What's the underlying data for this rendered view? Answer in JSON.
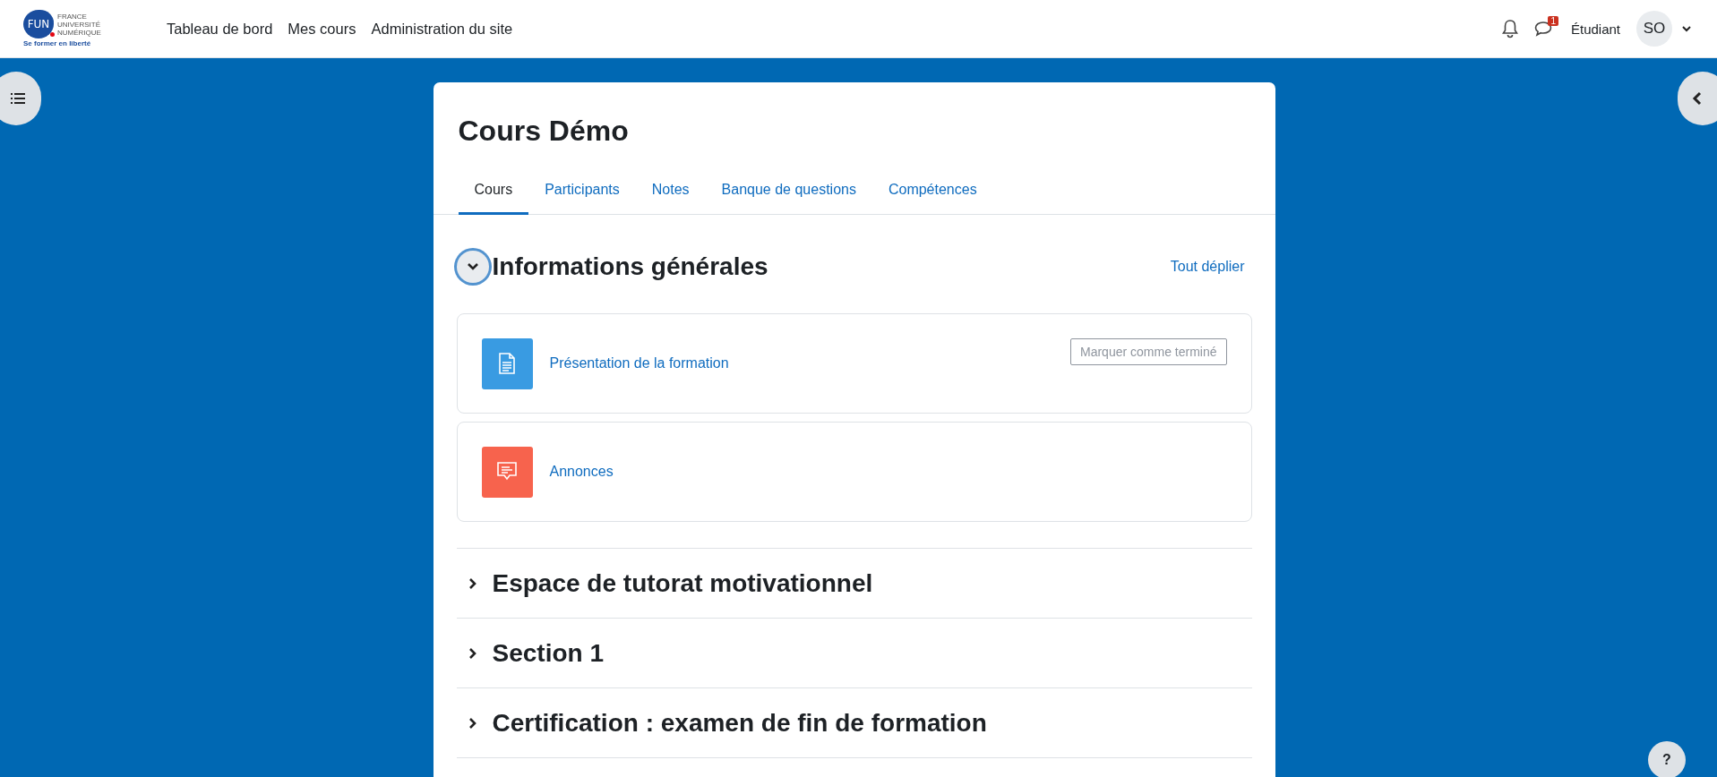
{
  "logo": {
    "mark": "FUN",
    "lines": [
      "FRANCE",
      "UNIVERSITÉ",
      "NUMÉRIQUE"
    ],
    "tagline": "Se former en liberté"
  },
  "nav": [
    {
      "label": "Tableau de bord"
    },
    {
      "label": "Mes cours"
    },
    {
      "label": "Administration du site"
    }
  ],
  "user": {
    "message_count": "1",
    "role": "Étudiant",
    "initials": "SO"
  },
  "course": {
    "title": "Cours Démo",
    "tabs": [
      {
        "label": "Cours",
        "selected": true
      },
      {
        "label": "Participants",
        "selected": false
      },
      {
        "label": "Notes",
        "selected": false
      },
      {
        "label": "Banque de questions",
        "selected": false
      },
      {
        "label": "Compétences",
        "selected": false
      }
    ],
    "expand_all": "Tout déplier",
    "sections": [
      {
        "title": "Informations générales",
        "expanded": true,
        "activities": [
          {
            "kind": "page",
            "name": "Présentation de la formation",
            "completion": "Marquer comme terminé"
          },
          {
            "kind": "forum",
            "name": "Annonces"
          }
        ]
      },
      {
        "title": "Espace de tutorat motivationnel",
        "expanded": false
      },
      {
        "title": "Section 1",
        "expanded": false
      },
      {
        "title": "Certification : examen de fin de formation",
        "expanded": false
      }
    ]
  },
  "help": "?"
}
